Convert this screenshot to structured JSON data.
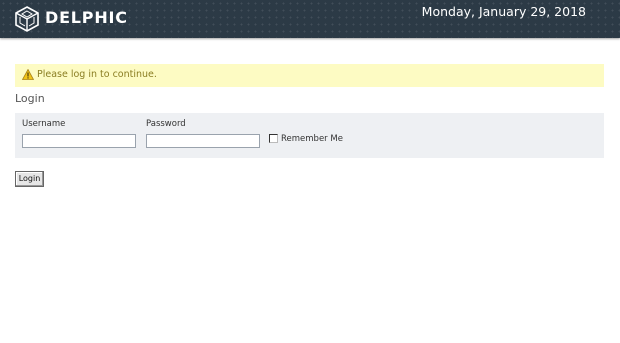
{
  "header": {
    "brand": "DELPHIC",
    "date": "Monday, January 29, 2018",
    "logo_icon": "cube-logo-icon"
  },
  "notice": {
    "icon": "warning-icon",
    "text": "Please log in to continue."
  },
  "login": {
    "heading": "Login",
    "username_label": "Username",
    "username_value": "",
    "password_label": "Password",
    "password_value": "",
    "remember_label": "Remember Me",
    "remember_checked": false,
    "submit_label": "Login"
  },
  "colors": {
    "header_bg": "#2c3a46",
    "notice_bg": "#fdfbc3",
    "notice_text": "#8a7d22",
    "panel_bg": "#eef0f3"
  }
}
